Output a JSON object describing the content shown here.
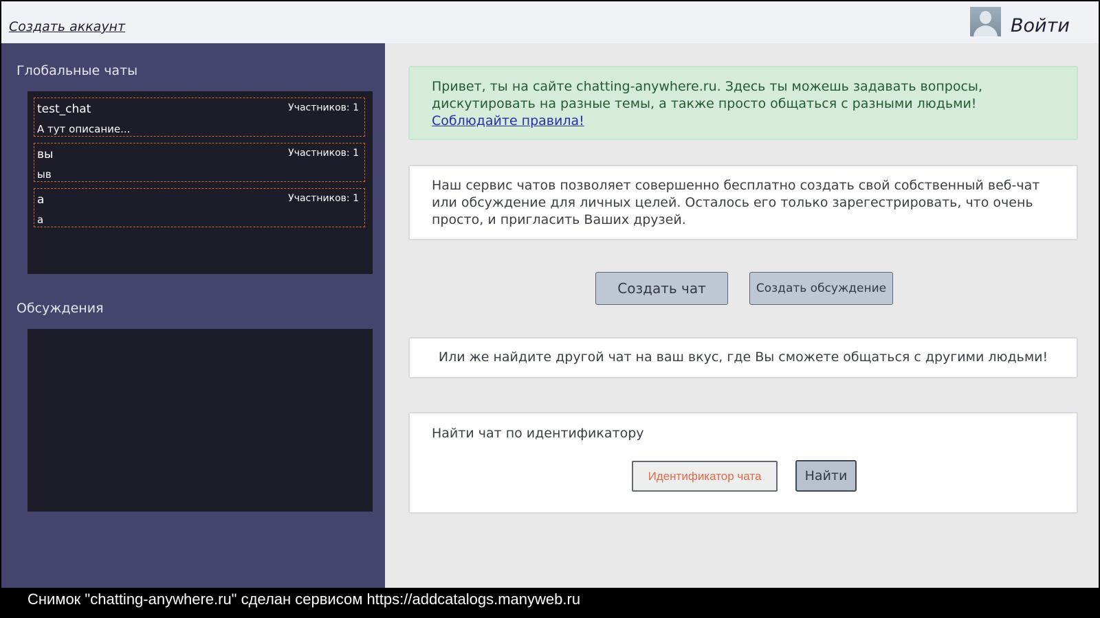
{
  "header": {
    "create_account": "Создать аккаунт",
    "login": "Войти"
  },
  "sidebar": {
    "global_title": "Глобальные чаты",
    "chats": [
      {
        "name": "test_chat",
        "description": "А тут описание...",
        "members": "Участников: 1"
      },
      {
        "name": "вы",
        "description": "ыв",
        "members": "Участников: 1"
      },
      {
        "name": "а",
        "description": "а",
        "members": "Участников: 1"
      }
    ],
    "discussions_title": "Обсуждения"
  },
  "main": {
    "welcome_text": "Привет, ты на сайте chatting-anywhere.ru. Здесь ты можешь задавать вопросы, дискутировать на разные темы, а также просто общаться с разными людьми! ",
    "rules_link": "Соблюдайте правила!",
    "info_text": "Наш сервис чатов позволяет совершенно бесплатно создать свой собственный веб-чат или обсуждение для личных целей. Осталось его только зарегестрировать, что очень просто, и пригласить Ваших друзей.",
    "create_chat": "Создать чат",
    "create_discussion": "Создать обсуждение",
    "other_text": "Или же найдите другой чат на ваш вкус, где Вы сможете общаться с другими людьми!",
    "find_title": "Найти чат по идентификатору",
    "find_placeholder": "Идентификатор чата",
    "find_button": "Найти"
  },
  "caption": "Снимок \"chatting-anywhere.ru\" сделан сервисом https://addcatalogs.manyweb.ru",
  "icons": {
    "avatar": "user-avatar-icon"
  },
  "colors": {
    "sidebar_bg": "#45446d",
    "panel_bg": "#1c1d29",
    "welcome_bg": "#d5ecda",
    "welcome_text": "#245a34",
    "button_bg": "#bfc7d4",
    "chat_border": "#d8662a",
    "placeholder": "#e16a44"
  }
}
